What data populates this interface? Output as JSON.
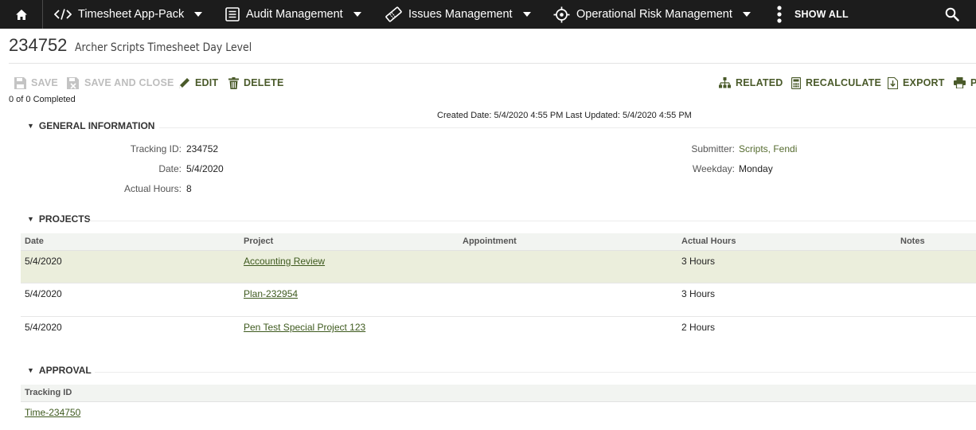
{
  "nav": {
    "items": [
      {
        "label": "Timesheet App-Pack",
        "icon": "code-icon"
      },
      {
        "label": "Audit Management",
        "icon": "document-icon"
      },
      {
        "label": "Issues Management",
        "icon": "ticket-icon"
      },
      {
        "label": "Operational Risk Management",
        "icon": "target-icon"
      }
    ],
    "show_all": "SHOW ALL"
  },
  "record": {
    "id": "234752",
    "name": "Archer Scripts Timesheet Day Level"
  },
  "toolbar": {
    "save": "SAVE",
    "save_and_close": "SAVE AND CLOSE",
    "edit": "EDIT",
    "delete": "DELETE",
    "related": "RELATED",
    "recalculate": "RECALCULATE",
    "export": "EXPORT",
    "print_partial": "P"
  },
  "status": {
    "completed": "0 of 0 Completed",
    "dates": "Created Date: 5/4/2020 4:55 PM Last Updated: 5/4/2020 4:55 PM"
  },
  "general": {
    "heading": "GENERAL INFORMATION",
    "tracking_id_label": "Tracking ID:",
    "tracking_id": "234752",
    "date_label": "Date:",
    "date": "5/4/2020",
    "actual_hours_label": "Actual Hours:",
    "actual_hours": "8",
    "submitter_label": "Submitter:",
    "submitter": "Scripts, Fendi",
    "weekday_label": "Weekday:",
    "weekday": "Monday"
  },
  "projects": {
    "heading": "PROJECTS",
    "columns": [
      "Date",
      "Project",
      "Appointment",
      "Actual Hours",
      "Notes"
    ],
    "rows": [
      {
        "date": "5/4/2020",
        "project": "Accounting Review",
        "appointment": "",
        "hours": "3 Hours",
        "notes": ""
      },
      {
        "date": "5/4/2020",
        "project": "Plan-232954",
        "appointment": "",
        "hours": "3 Hours",
        "notes": ""
      },
      {
        "date": "5/4/2020",
        "project": "Pen Test Special Project 123",
        "appointment": "",
        "hours": "2 Hours",
        "notes": ""
      }
    ]
  },
  "approval": {
    "heading": "APPROVAL",
    "column": "Tracking ID",
    "rows": [
      {
        "tracking_id": "Time-234750"
      }
    ]
  }
}
